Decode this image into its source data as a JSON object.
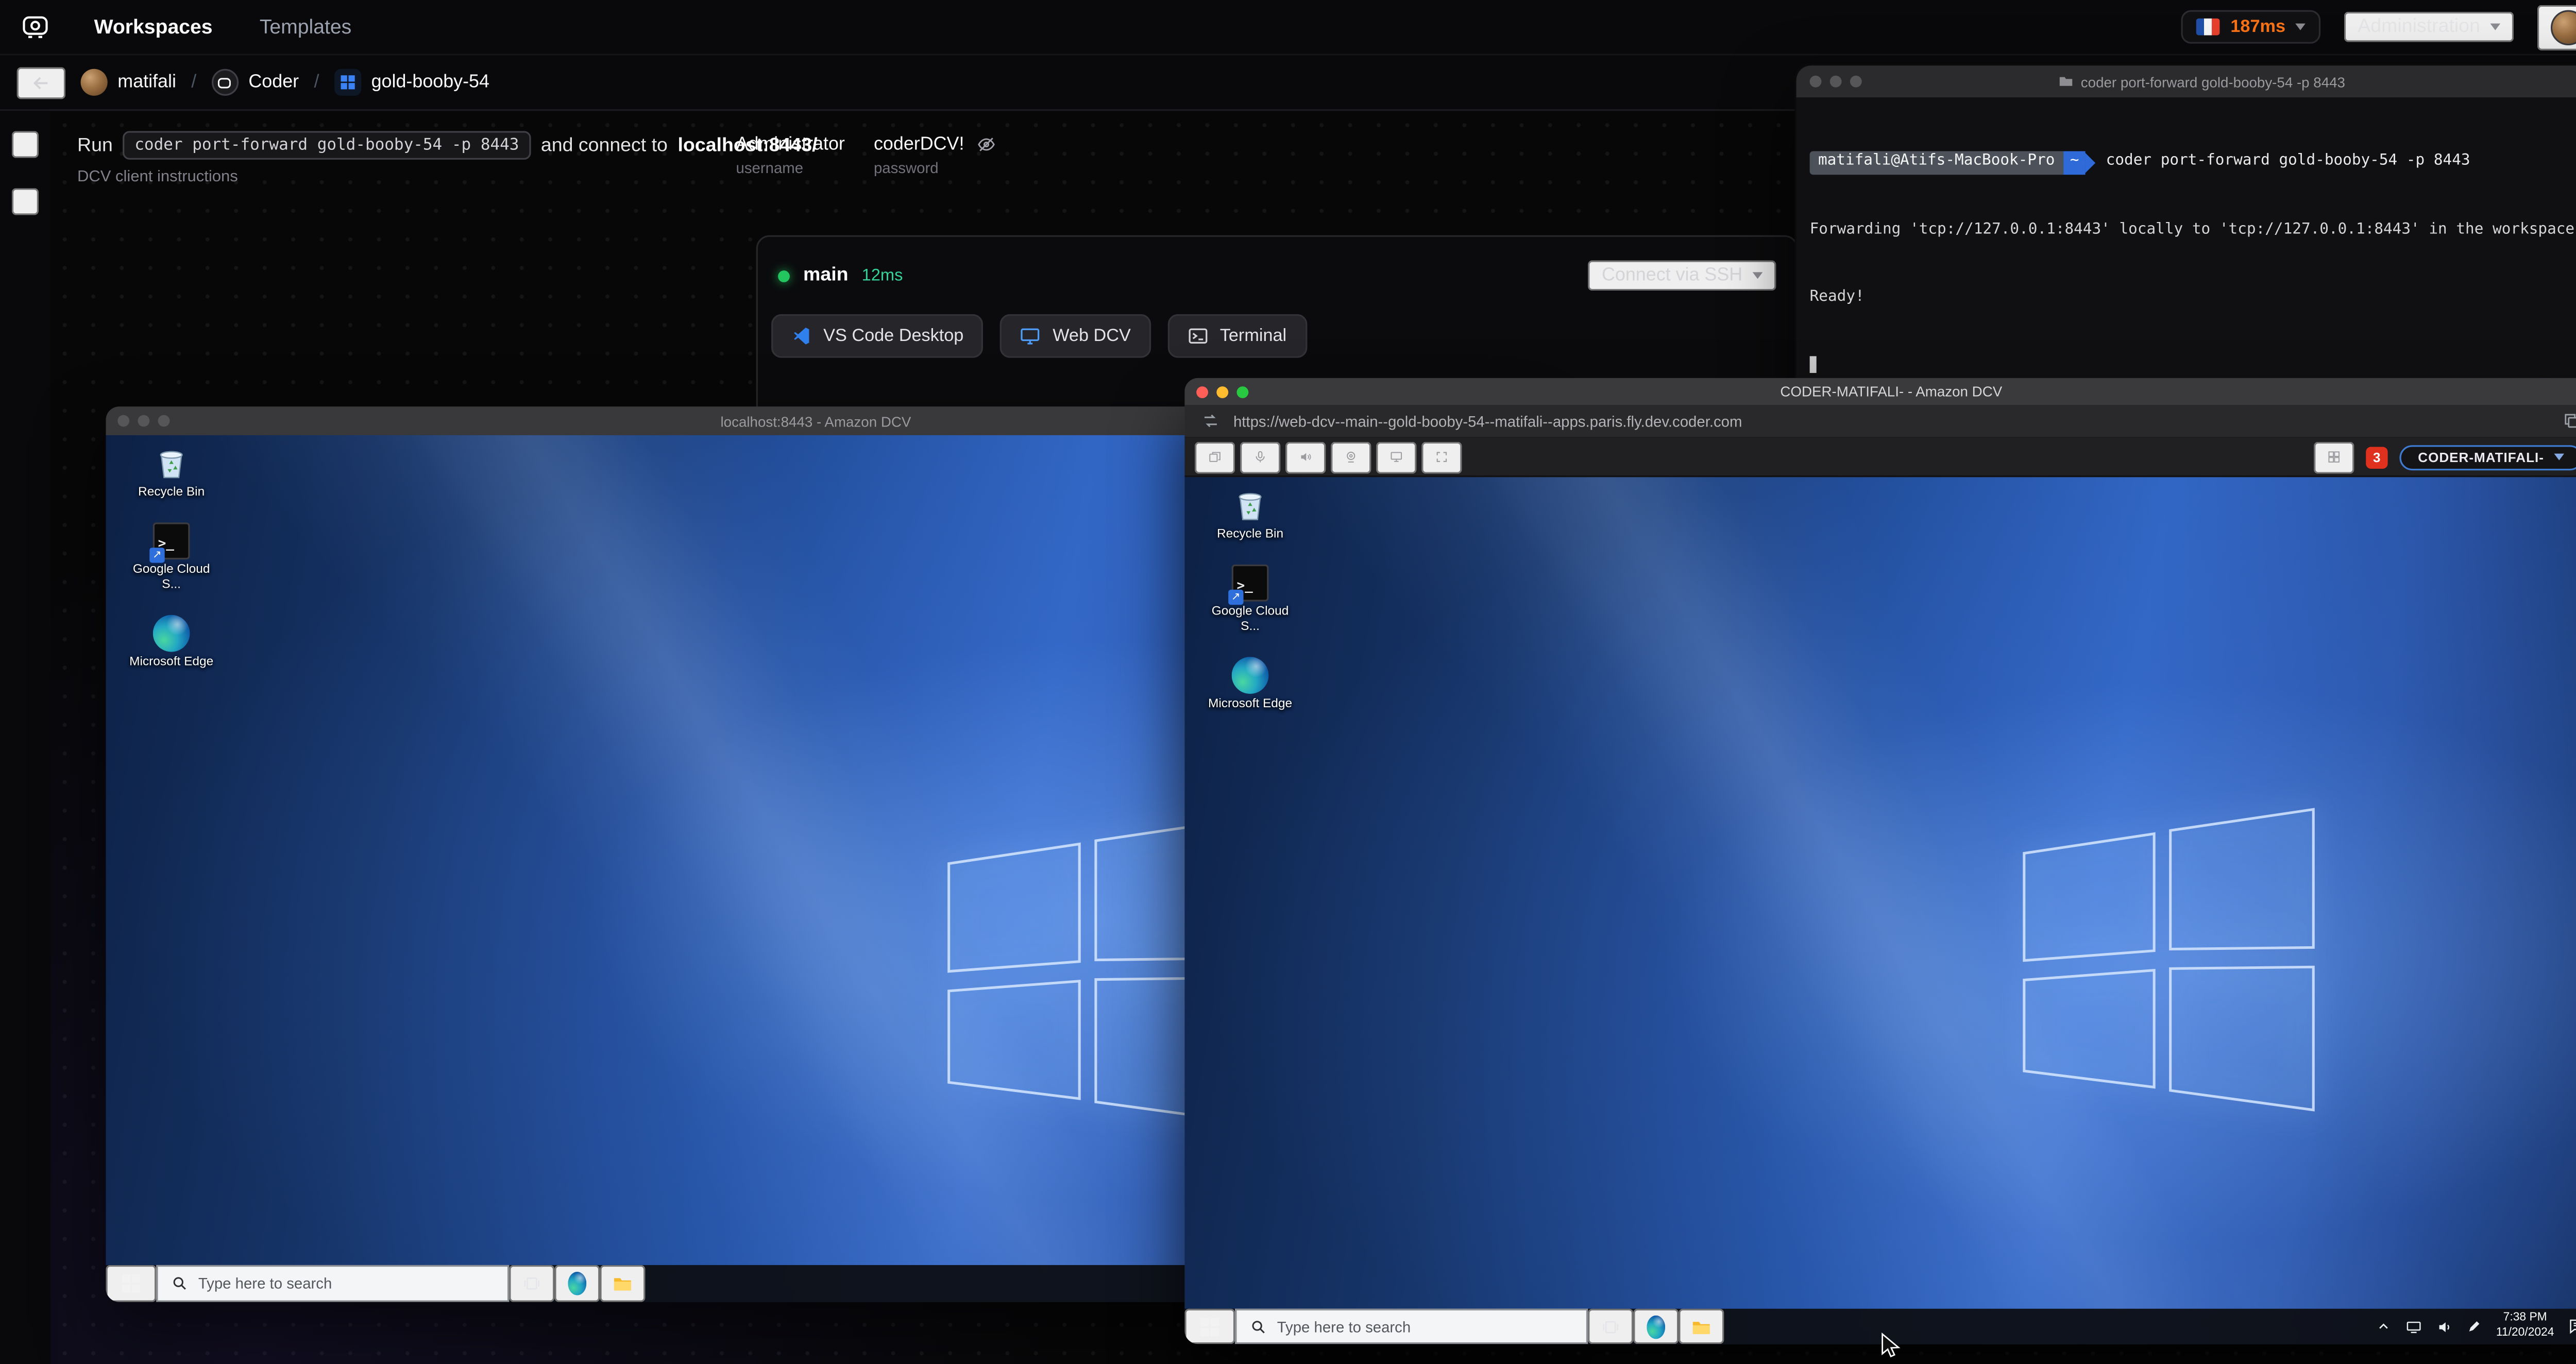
{
  "topnav": {
    "tabs": [
      {
        "label": "Workspaces"
      },
      {
        "label": "Templates"
      }
    ],
    "latency_value": "187ms",
    "admin_label": "Administration"
  },
  "breadcrumb": {
    "user": "matifali",
    "org": "Coder",
    "workspace": "gold-booby-54",
    "separator": "/"
  },
  "port_forward": {
    "run_prefix": "Run",
    "command": "coder port-forward gold-booby-54 -p 8443",
    "connect_text": "and connect to",
    "connect_target": "localhost:8443/",
    "client_link": "DCV client instructions",
    "username_value": "Administrator",
    "username_label": "username",
    "password_value": "coderDCV!",
    "password_label": "password"
  },
  "agent_card": {
    "name": "main",
    "latency": "12ms",
    "ssh_label": "Connect via SSH",
    "apps": [
      {
        "label": "VS Code Desktop"
      },
      {
        "label": "Web DCV"
      },
      {
        "label": "Terminal"
      }
    ]
  },
  "mac_terminal": {
    "title": "coder port-forward gold-booby-54 -p 8443",
    "prompt_user": "matifali@Atifs-MacBook-Pro",
    "prompt_path": "~",
    "command": "coder port-forward gold-booby-54 -p 8443",
    "output": [
      "Forwarding 'tcp://127.0.0.1:8443' locally to 'tcp://127.0.0.1:8443' in the workspace",
      "Ready!"
    ]
  },
  "dcv_back_window": {
    "title": "localhost:8443 - Amazon DCV",
    "desktop_icons": [
      "Recycle Bin",
      "Google Cloud S...",
      "Microsoft Edge"
    ],
    "taskbar_search": "Type here to search"
  },
  "dcv_front_window": {
    "title": "CODER-MATIFALI- - Amazon DCV",
    "url": "https://web-dcv--main--gold-booby-54--matifali--apps.paris.fly.dev.coder.com",
    "notification_count": "3",
    "session_label": "CODER-MATIFALI-",
    "desktop_icons": [
      "Recycle Bin",
      "Google Cloud S...",
      "Microsoft Edge"
    ],
    "taskbar_search": "Type here to search",
    "tray_time": "7:38 PM",
    "tray_date": "11/20/2024"
  }
}
